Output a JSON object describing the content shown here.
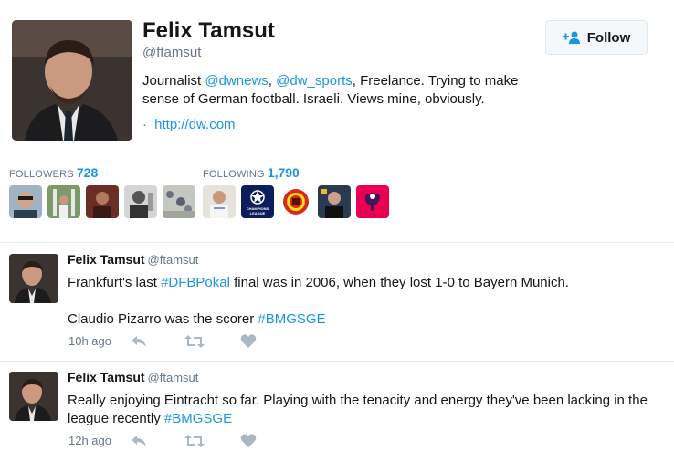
{
  "profile": {
    "name": "Felix Tamsut",
    "handle": "@ftamsut",
    "bio": {
      "prefix": "Journalist ",
      "mention1": "@dwnews",
      "separator": ", ",
      "mention2": "@dw_sports",
      "suffix": ", Freelance. Trying to make sense of German football. Israeli. Views mine, obviously."
    },
    "url_dot": "·",
    "url": "http://dw.com",
    "follow_label": "Follow"
  },
  "stats": {
    "followers_label": "FOLLOWERS",
    "followers_count": "728",
    "following_label": "FOLLOWING",
    "following_count": "1,790"
  },
  "following_badges": {
    "champions_league_line1": "CHAMPIONS",
    "champions_league_line2": "LEAGUE"
  },
  "tweets": [
    {
      "name": "Felix Tamsut",
      "handle": "@ftamsut",
      "line1_a": "Frankfurt's last ",
      "line1_tag": "#DFBPokal",
      "line1_b": " final was in 2006, when they lost 1-0 to Bayern Munich.",
      "line2_a": "Claudio Pizarro was the scorer ",
      "line2_tag": "#BMGSGE",
      "time": "10h ago"
    },
    {
      "name": "Felix Tamsut",
      "handle": "@ftamsut",
      "line1_a": "Really enjoying Eintracht so far. Playing with the tenacity and energy they've been lacking in the league recently ",
      "line1_tag": "#BMGSGE",
      "time": "12h ago"
    }
  ],
  "colors": {
    "link": "#1b95e0",
    "secondary_text": "#657786",
    "divider": "#e6ecf0",
    "action_icon": "#aab8c2"
  },
  "icons": [
    "follow-person-plus-icon",
    "reply-icon",
    "retweet-icon",
    "like-heart-icon"
  ]
}
